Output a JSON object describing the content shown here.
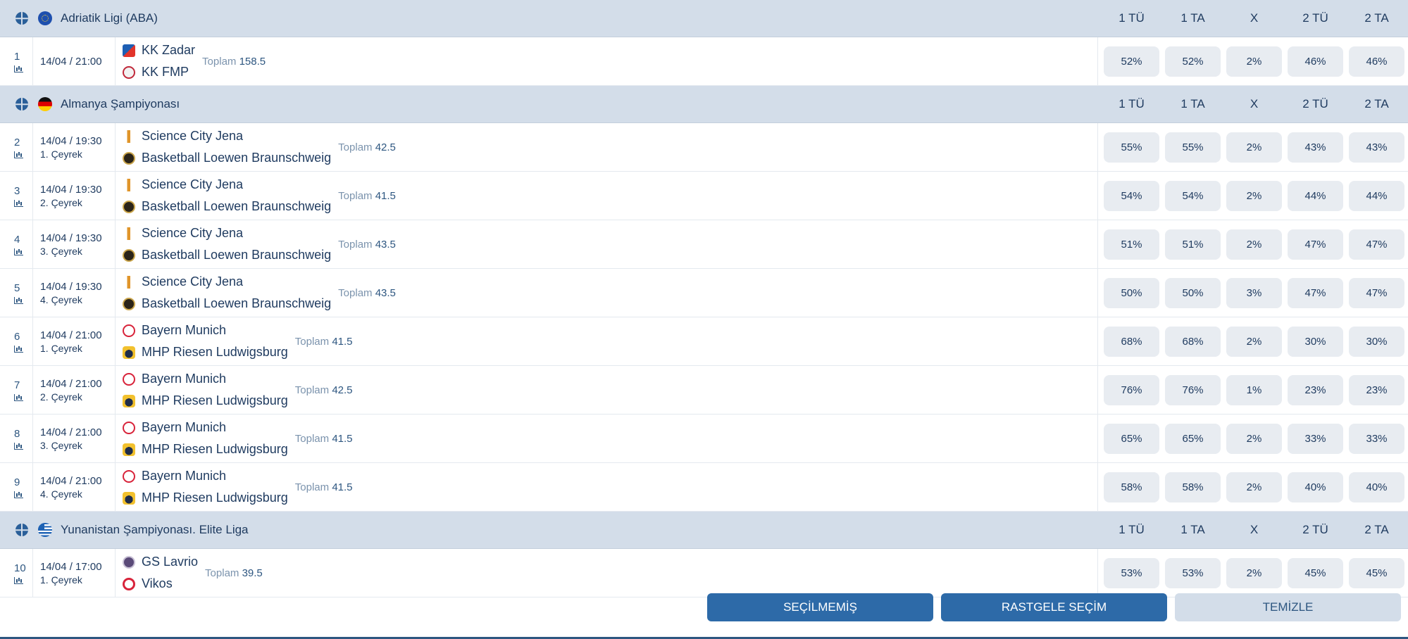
{
  "columns": [
    "1 TÜ",
    "1 TA",
    "X",
    "2 TÜ",
    "2 TA"
  ],
  "total_label": "Toplam",
  "leagues": [
    {
      "name": "Adriatik Ligi (ABA)",
      "flag": "eu-flag-icon",
      "matches": [
        {
          "num": "1",
          "time": "14/04 / 21:00",
          "period": "",
          "home": "KK Zadar",
          "away": "KK FMP",
          "total": "158.5",
          "odds": [
            "52%",
            "52%",
            "2%",
            "46%",
            "46%"
          ]
        }
      ]
    },
    {
      "name": "Almanya Şampiyonası",
      "flag": "germany-flag-icon",
      "matches": [
        {
          "num": "2",
          "time": "14/04 / 19:30",
          "period": "1. Çeyrek",
          "home": "Science City Jena",
          "away": "Basketball Loewen Braunschweig",
          "total": "42.5",
          "odds": [
            "55%",
            "55%",
            "2%",
            "43%",
            "43%"
          ]
        },
        {
          "num": "3",
          "time": "14/04 / 19:30",
          "period": "2. Çeyrek",
          "home": "Science City Jena",
          "away": "Basketball Loewen Braunschweig",
          "total": "41.5",
          "odds": [
            "54%",
            "54%",
            "2%",
            "44%",
            "44%"
          ]
        },
        {
          "num": "4",
          "time": "14/04 / 19:30",
          "period": "3. Çeyrek",
          "home": "Science City Jena",
          "away": "Basketball Loewen Braunschweig",
          "total": "43.5",
          "odds": [
            "51%",
            "51%",
            "2%",
            "47%",
            "47%"
          ]
        },
        {
          "num": "5",
          "time": "14/04 / 19:30",
          "period": "4. Çeyrek",
          "home": "Science City Jena",
          "away": "Basketball Loewen Braunschweig",
          "total": "43.5",
          "odds": [
            "50%",
            "50%",
            "3%",
            "47%",
            "47%"
          ]
        },
        {
          "num": "6",
          "time": "14/04 / 21:00",
          "period": "1. Çeyrek",
          "home": "Bayern Munich",
          "away": "MHP Riesen Ludwigsburg",
          "total": "41.5",
          "odds": [
            "68%",
            "68%",
            "2%",
            "30%",
            "30%"
          ]
        },
        {
          "num": "7",
          "time": "14/04 / 21:00",
          "period": "2. Çeyrek",
          "home": "Bayern Munich",
          "away": "MHP Riesen Ludwigsburg",
          "total": "42.5",
          "odds": [
            "76%",
            "76%",
            "1%",
            "23%",
            "23%"
          ]
        },
        {
          "num": "8",
          "time": "14/04 / 21:00",
          "period": "3. Çeyrek",
          "home": "Bayern Munich",
          "away": "MHP Riesen Ludwigsburg",
          "total": "41.5",
          "odds": [
            "65%",
            "65%",
            "2%",
            "33%",
            "33%"
          ]
        },
        {
          "num": "9",
          "time": "14/04 / 21:00",
          "period": "4. Çeyrek",
          "home": "Bayern Munich",
          "away": "MHP Riesen Ludwigsburg",
          "total": "41.5",
          "odds": [
            "58%",
            "58%",
            "2%",
            "40%",
            "40%"
          ]
        }
      ]
    },
    {
      "name": "Yunanistan Şampiyonası. Elite Liga",
      "flag": "greece-flag-icon",
      "matches": [
        {
          "num": "10",
          "time": "14/04 / 17:00",
          "period": "1. Çeyrek",
          "home": "GS Lavrio",
          "away": "Vikos",
          "total": "39.5",
          "odds": [
            "53%",
            "53%",
            "2%",
            "45%",
            "45%"
          ]
        }
      ]
    }
  ],
  "buttons": {
    "unselected": "SEÇİLMEMİŞ",
    "random": "RASTGELE SEÇİM",
    "clear": "TEMİZLE"
  }
}
